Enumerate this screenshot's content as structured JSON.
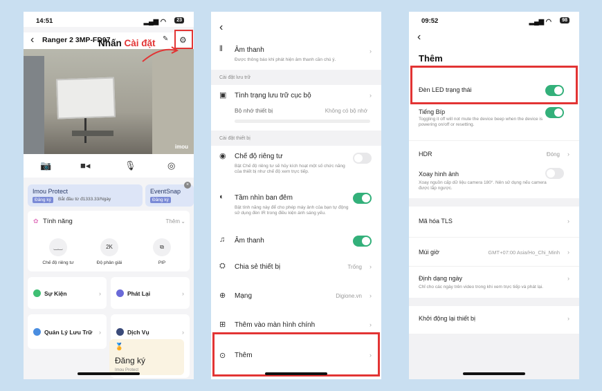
{
  "phone1": {
    "time": "14:51",
    "battery": "23",
    "camera_name": "Ranger 2 3MP-FD97",
    "annotation_prefix": "Nhấn",
    "annotation_highlight": "Cài đặt",
    "cam_brand": "imou",
    "subscription": {
      "name": "Imou Protect",
      "tag": "Đăng ký",
      "text": "Bắt đầu từ đ1333.33/Ngày",
      "name2": "EventSnap",
      "tag2": "Đăng ký"
    },
    "features": {
      "title": "Tính năng",
      "more": "Thêm",
      "items": [
        {
          "icon": "‿‿",
          "label": "Chế độ riêng tư"
        },
        {
          "icon": "2K",
          "label": "Độ phân giải"
        },
        {
          "icon": "⧉",
          "label": "PIP"
        }
      ]
    },
    "tiles": {
      "events": "Sự Kiện",
      "playback": "Phát Lại",
      "storage": "Quản Lý Lưu Trữ",
      "services": "Dịch Vụ"
    },
    "promo": {
      "big": "Đăng ký",
      "small": "Imou Protect"
    }
  },
  "phone2": {
    "top_row": {
      "label": "Âm thanh",
      "desc": "Được thông báo khi phát hiện âm thanh cần chú ý."
    },
    "section_storage": "Cài đặt lưu trữ",
    "storage_status": "Tình trạng lưu trữ cục bộ",
    "device_storage": "Bộ nhớ thiết bị",
    "no_storage": "Không có bộ nhớ",
    "section_device": "Cài đặt thiết bị",
    "privacy": {
      "label": "Chế độ riêng tư",
      "desc": "Bật Chế độ riêng tư sẽ hủy kích hoạt một số chức năng của thiết bị như chế độ xem trực tiếp.",
      "on": false
    },
    "night": {
      "label": "Tầm nhìn ban đêm",
      "desc": "Bật tính năng này để cho phép máy ảnh của bạn tự động sử dụng đèn IR trong điều kiện ánh sáng yếu.",
      "on": true
    },
    "audio": {
      "label": "Âm thanh",
      "on": true
    },
    "share": {
      "label": "Chia sẻ thiết bị",
      "value": "Trống"
    },
    "network": {
      "label": "Mạng",
      "value": "Digione.vn"
    },
    "home_screen": {
      "label": "Thêm vào màn hình chính"
    },
    "more": {
      "label": "Thêm"
    }
  },
  "phone3": {
    "time": "09:52",
    "battery": "98",
    "title": "Thêm",
    "led": {
      "label": "Đèn LED trạng thái",
      "on": true
    },
    "beep": {
      "label": "Tiếng Bíp",
      "desc": "Toggling it off will not mute the device beep when the device is powering on/off or resetting.",
      "on": true
    },
    "hdr": {
      "label": "HDR",
      "value": "Đóng"
    },
    "rotate": {
      "label": "Xoay hình ảnh",
      "desc": "Xoay nguồn cấp dữ liệu camera 180°. Nên sử dụng nếu camera được lắp ngược.",
      "on": false
    },
    "tls": {
      "label": "Mã hóa TLS"
    },
    "timezone": {
      "label": "Múi giờ",
      "value": "GMT+07:00 Asia/Ho_Chi_Minh"
    },
    "date_format": {
      "label": "Định dạng ngày",
      "desc": "Chỉ cho các ngày trên video trong khi xem trực tiếp và phát lại."
    },
    "reboot": {
      "label": "Khởi động lại thiết bị"
    }
  },
  "colors": {
    "accent_red": "#e23434",
    "toggle_green": "#33b07a"
  }
}
